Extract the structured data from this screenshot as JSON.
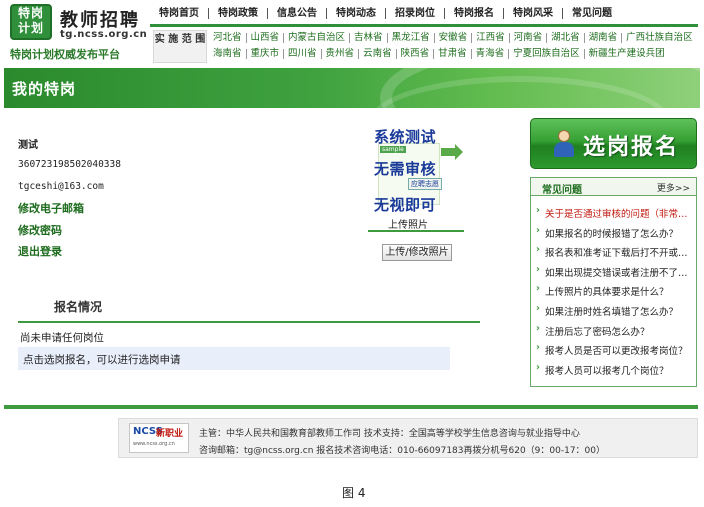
{
  "header": {
    "logo": {
      "line1": "特岗",
      "line2": "计划"
    },
    "site_name": "教师招聘",
    "site_url": "tg.ncss.org.cn",
    "slogan": "特岗计划权威发布平台",
    "nav": [
      "特岗首页",
      "特岗政策",
      "信息公告",
      "特岗动态",
      "招录岗位",
      "特岗报名",
      "特岗风采",
      "常见问题"
    ],
    "scope_label": "实 施 范 围",
    "provinces_row1": [
      "河北省",
      "山西省",
      "内蒙古自治区",
      "吉林省",
      "黑龙江省",
      "安徽省",
      "江西省",
      "河南省",
      "湖北省",
      "湖南省",
      "广西壮族自治区"
    ],
    "provinces_row2": [
      "海南省",
      "重庆市",
      "四川省",
      "贵州省",
      "云南省",
      "陕西省",
      "甘肃省",
      "青海省",
      "宁夏回族自治区",
      "新疆生产建设兵团"
    ]
  },
  "banner": {
    "title": "我的特岗"
  },
  "user": {
    "name": "测试",
    "id_card": "360723198502040338",
    "email": "tgceshi@163.com",
    "links": {
      "edit_email": "修改电子邮箱",
      "edit_password": "修改密码",
      "logout": "退出登录"
    }
  },
  "photo": {
    "text1": "系统测试",
    "text2": "无需审核",
    "text3": "无视即可",
    "stamp1": "sample",
    "stamp2": "应聘志愿",
    "caption": "上传照片",
    "upload_button": "上传/修改照片"
  },
  "application": {
    "title": "报名情况",
    "empty_message": "尚未申请任何岗位",
    "hint": "点击选岗报名，可以进行选岗申请"
  },
  "sidebar": {
    "apply_button": "选岗报名",
    "faq_title": "常见问题",
    "faq_more": "更多>>",
    "faq_items": [
      "关于是否通过审核的问题（非常重要）",
      "如果报名的时候报错了怎么办？",
      "报名表和准考证下载后打不开或者乱码怎么办？",
      "如果出现提交错误或者注册不了的情况怎么办？",
      "上传照片的具体要求是什么？",
      "如果注册时姓名填错了怎么办？",
      "注册后忘了密码怎么办？",
      "报考人员是否可以更改报考岗位？",
      "报考人员可以报考几个岗位？"
    ]
  },
  "footer": {
    "logo_ncss": "NCSS",
    "logo_xzy": "新职业",
    "logo_sub": "www.ncss.org.cn",
    "line1": "主管：中华人民共和国教育部教师工作司  技术支持：全国高等学校学生信息咨询与就业指导中心",
    "line2": "咨询邮箱：tg@ncss.org.cn  报名技术咨询电话：010-66097183再拨分机号620（9：00-17：00）"
  },
  "figure_caption": "图 4",
  "colors": {
    "brand_green": "#2f8f3a",
    "faq_active": "#c0180f",
    "hint_bg": "#e8eefa"
  }
}
